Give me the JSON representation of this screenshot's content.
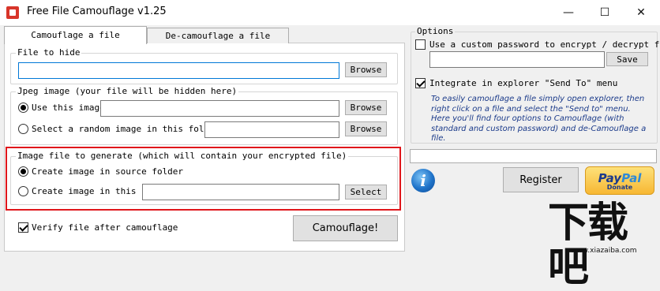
{
  "window": {
    "title": "Free File Camouflage v1.25",
    "minimize_glyph": "—",
    "maximize_glyph": "☐",
    "close_glyph": "✕"
  },
  "tabs": [
    {
      "label": "Camouflage a file",
      "active": true
    },
    {
      "label": "De-camouflage a file",
      "active": false
    }
  ],
  "file_to_hide": {
    "legend": "File to hide",
    "value": "",
    "browse_label": "Browse"
  },
  "jpeg_image": {
    "legend": "Jpeg image (your file will be hidden here)",
    "option_use": "Use this image:",
    "option_use_selected": true,
    "use_value": "",
    "option_random": "Select a random image in this folder:",
    "random_value": "",
    "browse_label": "Browse"
  },
  "generate": {
    "legend": "Image file to generate (which will contain your encrypted file)",
    "option_source": "Create image in source folder",
    "option_source_selected": true,
    "option_folder": "Create image in this folder:",
    "folder_value": "",
    "select_label": "Select",
    "highlight_color": "#e0161b"
  },
  "verify": {
    "label": "Verify file after camouflage",
    "checked": true
  },
  "camouflage_button": "Camouflage!",
  "options": {
    "legend": "Options",
    "custom_password_label": "Use a custom password to encrypt / decrypt file",
    "custom_password_checked": false,
    "password_value": "",
    "save_label": "Save",
    "integrate_label": "Integrate in explorer \"Send To\" menu",
    "integrate_checked": true,
    "info_text": "To easily camouflage a file simply open explorer, then right click on a file and select the \"Send to\" menu. Here you'll find four options to Camouflage (with standard and custom password) and de-Camouflage a file."
  },
  "status_value": "",
  "info_icon": "info-icon",
  "register_label": "Register",
  "paypal": {
    "word_part1": "Pay",
    "word_part2": "Pal",
    "donate": "Donate"
  },
  "watermark": {
    "text": "下载吧",
    "url": "www.xiazaiba.com"
  }
}
